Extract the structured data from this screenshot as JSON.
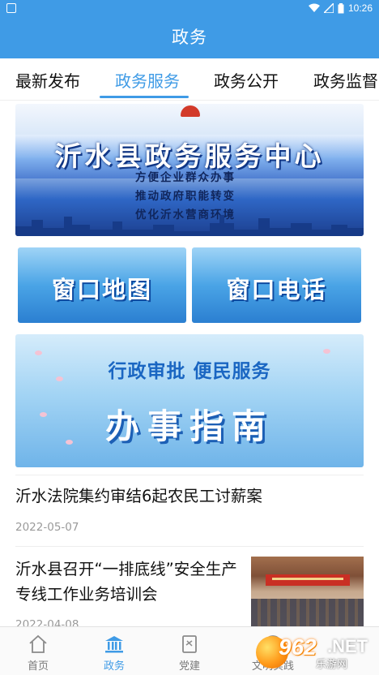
{
  "status_bar": {
    "time": "10:26"
  },
  "header": {
    "title": "政务"
  },
  "tabs": [
    {
      "label": "最新发布",
      "active": false
    },
    {
      "label": "政务服务",
      "active": true
    },
    {
      "label": "政务公开",
      "active": false
    },
    {
      "label": "政务监督",
      "active": false
    }
  ],
  "banners": {
    "center": {
      "headline": "沂水县政务服务中心",
      "lines": [
        "方便企业群众办事",
        "推动政府职能转变",
        "优化沂水营商环境"
      ]
    },
    "map_tile": "窗口地图",
    "phone_tile": "窗口电话",
    "guide": {
      "subtitle": "行政审批  便民服务",
      "title": "办事指南"
    }
  },
  "news": [
    {
      "title": "沂水法院集约审结6起农民工讨薪案",
      "date": "2022-05-07"
    },
    {
      "title": "沂水县召开“一排底线”安全生产专线工作业务培训会",
      "date": "2022-04-08"
    }
  ],
  "bottom_nav": [
    {
      "label": "首页",
      "icon": "home-icon",
      "active": false
    },
    {
      "label": "政务",
      "icon": "government-building-icon",
      "active": true
    },
    {
      "label": "党建",
      "icon": "party-book-icon",
      "active": false
    },
    {
      "label": "文明实践",
      "icon": "civilization-icon",
      "active": false
    }
  ],
  "watermark": {
    "number": "962",
    "suffix": ".NET",
    "name": "乐游网"
  },
  "colors": {
    "accent": "#3f9be6"
  }
}
